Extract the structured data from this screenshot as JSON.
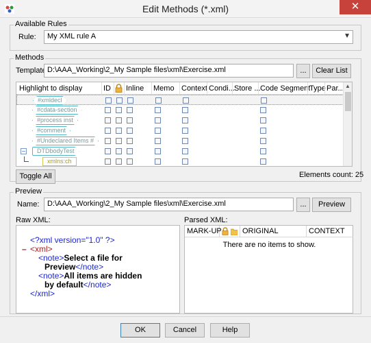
{
  "window": {
    "title": "Edit Methods (*.xml)",
    "close_glyph": "✕"
  },
  "rules": {
    "group_label": "Available Rules",
    "rule_label": "Rule:",
    "rule_value": "My XML rule A"
  },
  "methods": {
    "group_label": "Methods",
    "template_label": "Template:",
    "template_value": "D:\\AAA_Working\\2_My Sample files\\xml\\Exercise.xml",
    "browse_label": "...",
    "clear_list_label": "Clear List",
    "columns": [
      "Highlight to display",
      "ID",
      "",
      "Inline",
      "Memo",
      "Context",
      "Condi...",
      "Store ...",
      "Code Segment",
      "Type",
      "Par..."
    ],
    "lock_icon": "lock-icon",
    "rows": [
      {
        "tag": "#xmldecl"
      },
      {
        "tag": "#cdata-section"
      },
      {
        "tag": "#process inst"
      },
      {
        "tag": "#comment"
      },
      {
        "tag": "#Undeclared Items #"
      },
      {
        "tag": "DTDbodyTest"
      },
      {
        "tag": "xmlns:ch"
      }
    ],
    "toggle_all_label": "Toggle All",
    "elements_count": "Elements count: 25"
  },
  "preview": {
    "group_label": "Preview",
    "name_label": "Name:",
    "name_value": "D:\\AAA_Working\\2_My Sample files\\xml\\Exercise.xml",
    "browse_label": "...",
    "preview_button_label": "Preview",
    "raw_label": "Raw XML:",
    "parsed_label": "Parsed XML:",
    "raw_xml": {
      "decl": "<?xml version=\"1.0\" ?>",
      "collapse": "–",
      "open_xml": "<xml>",
      "note_open": "<note>",
      "note_close": "</note>",
      "note1_text_a": "Select a file for",
      "note1_text_b": "Preview",
      "note2_text_a": "All items are hidden",
      "note2_text_b": "by default",
      "close_xml": "</xml>"
    },
    "parsed_columns": [
      "MARK-UP",
      "ORIGINAL",
      "CONTEXT"
    ],
    "empty_message": "There are no items to show."
  },
  "footer": {
    "ok_label": "OK",
    "cancel_label": "Cancel",
    "help_label": "Help"
  },
  "colors": {
    "accent": "#1a25d6",
    "tag_border": "#4fb8c4",
    "close_red": "#c7423a"
  }
}
